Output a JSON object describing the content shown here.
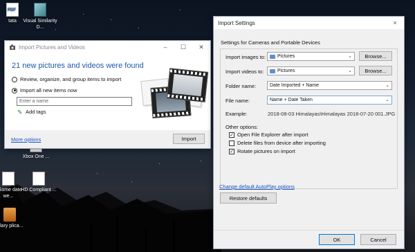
{
  "desktop": {
    "icons": [
      {
        "label": "tata"
      },
      {
        "label": "Visual Similarity D..."
      },
      {
        "label": "Xbox One ..."
      },
      {
        "label": "x Some date we..."
      },
      {
        "label": "HD Compliant ..."
      },
      {
        "label": "Glary plica..."
      }
    ],
    "pdf_badge": "PDF"
  },
  "import_window": {
    "title": "Import Pictures and Videos",
    "heading": "21 new pictures and videos were found",
    "option_review": "Review, organize, and group items to import",
    "option_import_all": "Import all new items now",
    "name_placeholder": "Enter a name",
    "add_tags": "Add tags",
    "more_options": "More options",
    "import_button": "Import"
  },
  "settings_dialog": {
    "title": "Import Settings",
    "section_title": "Settings for Cameras and Portable Devices",
    "import_images_label": "Import images to:",
    "import_images_value": "Pictures",
    "import_videos_label": "Import videos to:",
    "import_videos_value": "Pictures",
    "browse_label": "Browse...",
    "folder_name_label": "Folder name:",
    "folder_name_value": "Date Imported + Name",
    "file_name_label": "File name:",
    "file_name_value": "Name + Date Taken",
    "example_label": "Example:",
    "example_value": "2018-08-03 Himalayas\\Himalayas 2018-07-20 001.JPG",
    "other_options_label": "Other options:",
    "options": [
      {
        "label": "Open File Explorer after import",
        "checked": true
      },
      {
        "label": "Delete files from device after importing",
        "checked": false
      },
      {
        "label": "Rotate pictures on import",
        "checked": true
      }
    ],
    "autoplay_link": "Change default AutoPlay options",
    "restore_defaults": "Restore defaults",
    "ok": "OK",
    "cancel": "Cancel",
    "close_glyph": "×"
  }
}
